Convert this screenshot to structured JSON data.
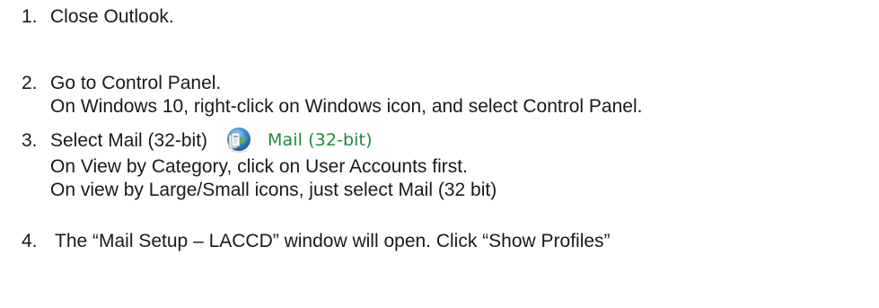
{
  "steps": [
    {
      "number": "1.",
      "lines": [
        "Close Outlook."
      ]
    },
    {
      "number": "2.",
      "lines": [
        "Go to Control Panel.",
        "On Windows 10, right-click on Windows icon, and select Control Panel."
      ]
    },
    {
      "number": "3.",
      "lines": [
        "Select Mail (32-bit)",
        "On View by Category, click on User Accounts first.",
        "On view by Large/Small icons, just select Mail (32 bit)"
      ]
    },
    {
      "number": "4.",
      "lines": [
        "The “Mail Setup – LACCD” window will open. Click “Show Profiles”"
      ]
    }
  ],
  "control_panel_item": {
    "icon": "mail-control-panel-icon",
    "label": "Mail (32-bit)",
    "label_color": "#1e8a3c"
  }
}
